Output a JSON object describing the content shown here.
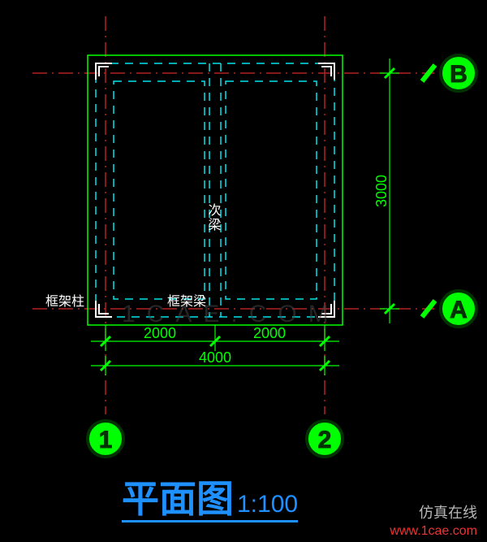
{
  "title": {
    "text": "平面图",
    "scale": "1:100"
  },
  "watermark": "仿真在线",
  "url": "www.1cae.com",
  "faint_mark": "1CAE.COM",
  "grid_labels": {
    "axis_1": "1",
    "axis_2": "2",
    "axis_A": "A",
    "axis_B": "B"
  },
  "dimensions": {
    "span_half_left": "2000",
    "span_half_right": "2000",
    "total_width": "4000",
    "height": "3000"
  },
  "text_labels": {
    "column": "框架柱",
    "beam": "框架梁",
    "secondary_beam": "次梁"
  },
  "colors": {
    "axis_line": "#b22222",
    "construction": "#00ff00",
    "dashed": "#00e5ee",
    "corner": "#ffffff",
    "label_text": "#ffffff",
    "bubble_fill": "#00ff00",
    "bubble_stroke": "#003300",
    "title": "#1e90ff"
  }
}
